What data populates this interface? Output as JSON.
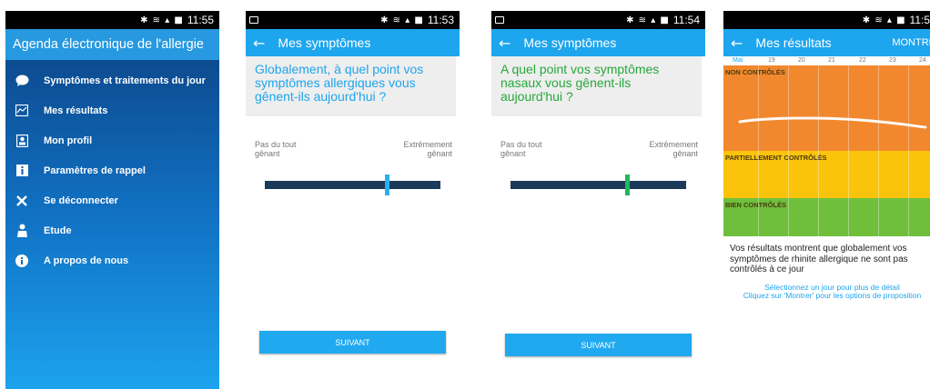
{
  "status_times": {
    "s1": "11:55",
    "s2": "11:53",
    "s3": "11:54",
    "s4": "11:5"
  },
  "status_icons": "✱ ≋ ▴ ■",
  "menu_screen": {
    "title": "Agenda électronique de l'allergie",
    "items": [
      {
        "label": "Symptômes et traitements du jour",
        "icon": "speech-bubble-icon"
      },
      {
        "label": "Mes résultats",
        "icon": "chart-icon"
      },
      {
        "label": "Mon profil",
        "icon": "profile-card-icon"
      },
      {
        "label": "Paramètres de rappel",
        "icon": "info-square-icon"
      },
      {
        "label": "Se déconnecter",
        "icon": "close-icon"
      },
      {
        "label": "Etude",
        "icon": "person-icon"
      },
      {
        "label": "A propos de nous",
        "icon": "info-circle-icon"
      }
    ]
  },
  "symptoms_screen_1": {
    "title": "Mes symptômes",
    "question": "Globalement, à quel point vos symptômes allergiques vous gênent-ils aujourd'hui ?",
    "scale_min": "Pas du tout gênant",
    "scale_max": "Extrêmement gênant",
    "slider_level": 0.68,
    "button": "SUIVANT"
  },
  "symptoms_screen_2": {
    "title": "Mes symptômes",
    "question": "A quel point vos symptômes nasaux vous gênent-ils aujourd'hui ?",
    "scale_min": "Pas du tout gênant",
    "scale_max": "Extrêmement gênant",
    "slider_level": 0.66,
    "button": "SUIVANT"
  },
  "results_screen": {
    "title": "Mes résultats",
    "action": "MONTRE",
    "zones": {
      "uncontrolled": "NON CONTRÔLÉS",
      "partial": "PARTIELLEMENT CONTRÔLÉS",
      "controlled": "BIEN CONTRÔLÉS"
    },
    "zone_colors": {
      "uncontrolled": "#f2882d",
      "partial": "#fbc40b",
      "controlled": "#6fbf3c"
    },
    "days": [
      "Mai",
      "19",
      "20",
      "21",
      "22",
      "23",
      "24"
    ],
    "summary": "Vos résultats montrent que globalement vos symptômes de rhinite allergique ne sont pas contrôlés à ce jour",
    "help_line1": "Sélectionnez un jour pour plus de détail",
    "help_line2": "Cliquez sur 'Montrer' pour les options de proposition"
  }
}
